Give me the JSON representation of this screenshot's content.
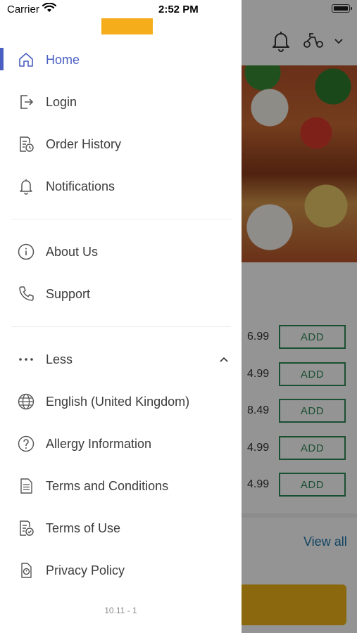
{
  "status_bar": {
    "carrier": "Carrier",
    "time": "2:52 PM"
  },
  "drawer": {
    "menu_primary": [
      {
        "label": "Home",
        "icon": "home-icon",
        "active": true
      },
      {
        "label": "Login",
        "icon": "login-icon"
      },
      {
        "label": "Order History",
        "icon": "order-history-icon"
      },
      {
        "label": "Notifications",
        "icon": "bell-icon"
      }
    ],
    "menu_secondary": [
      {
        "label": "About Us",
        "icon": "info-icon"
      },
      {
        "label": "Support",
        "icon": "phone-icon"
      }
    ],
    "less_toggle": {
      "label": "Less",
      "icon": "more-dots-icon"
    },
    "menu_more": [
      {
        "label": "English (United Kingdom)",
        "icon": "globe-icon"
      },
      {
        "label": "Allergy Information",
        "icon": "question-icon"
      },
      {
        "label": "Terms and Conditions",
        "icon": "document-icon"
      },
      {
        "label": "Terms of Use",
        "icon": "terms-check-icon"
      },
      {
        "label": "Privacy Policy",
        "icon": "privacy-icon"
      }
    ],
    "version": "10.11 - 1"
  },
  "background": {
    "prices": [
      "6.99",
      "4.99",
      "8.49",
      "4.99",
      "4.99"
    ],
    "add_label": "ADD",
    "view_all": "View all",
    "colors": {
      "accent": "#4a5fc1",
      "add_green": "#2e8b57",
      "brand_yellow": "#f5ad1b"
    }
  }
}
